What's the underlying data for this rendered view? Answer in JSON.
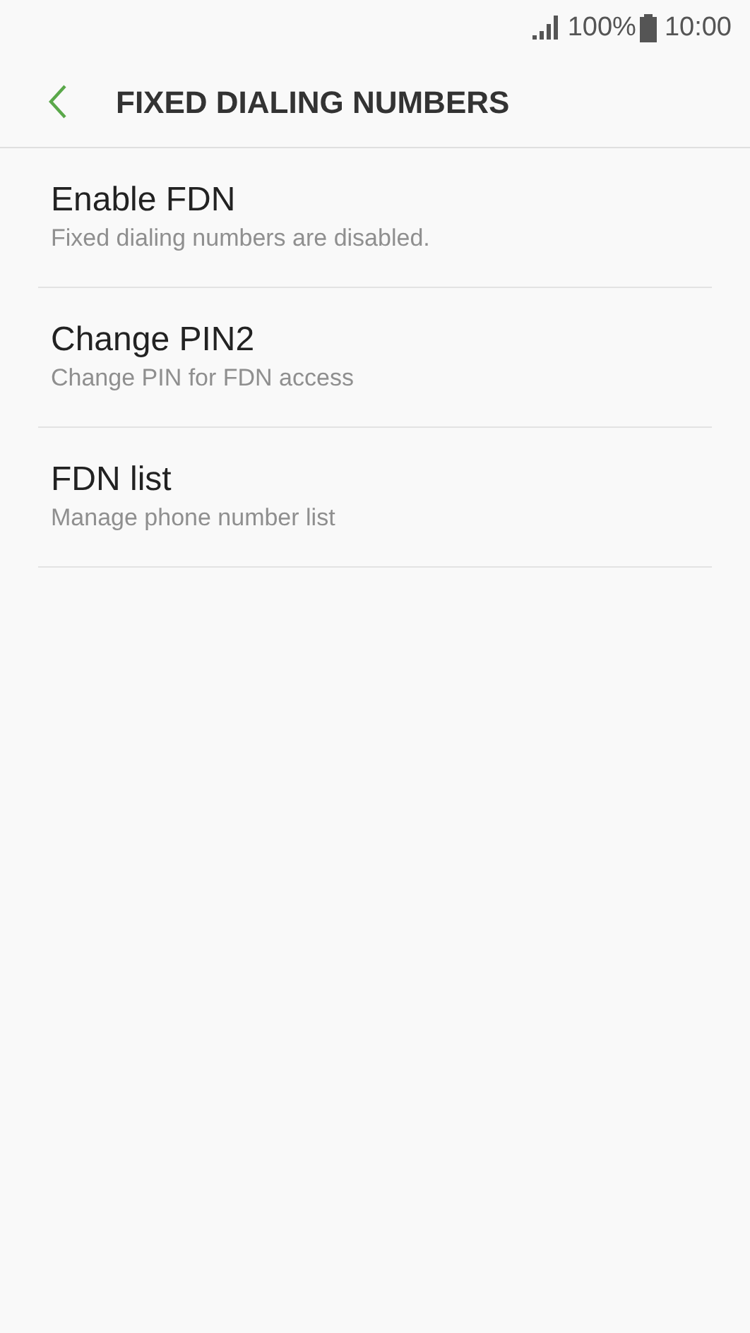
{
  "status_bar": {
    "battery": "100%",
    "time": "10:00"
  },
  "header": {
    "title": "FIXED DIALING NUMBERS"
  },
  "items": [
    {
      "title": "Enable FDN",
      "subtitle": "Fixed dialing numbers are disabled."
    },
    {
      "title": "Change PIN2",
      "subtitle": "Change PIN for FDN access"
    },
    {
      "title": "FDN list",
      "subtitle": "Manage phone number list"
    }
  ]
}
